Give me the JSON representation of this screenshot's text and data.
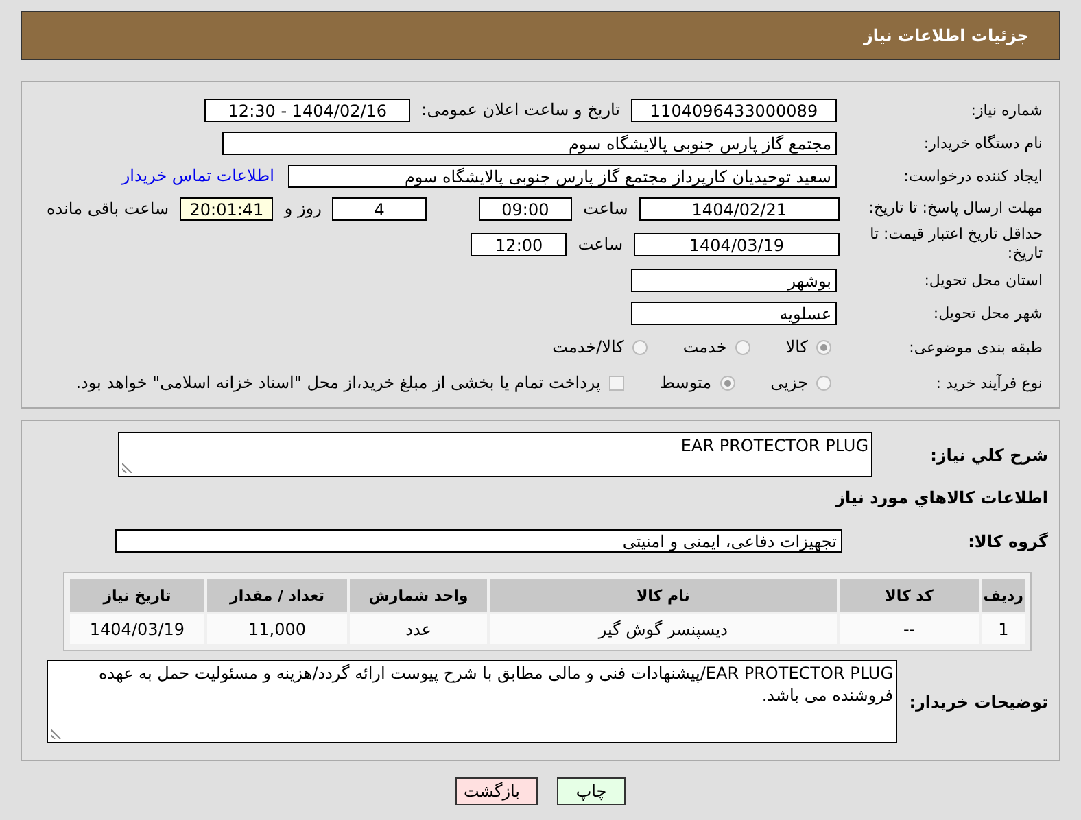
{
  "header": {
    "title": "جزئیات اطلاعات نیاز"
  },
  "need_info": {
    "need_number": {
      "label": "شماره نیاز:",
      "value": "1104096433000089"
    },
    "announce": {
      "label": "تاریخ و ساعت اعلان عمومی:",
      "value": "1404/02/16 - 12:30"
    },
    "buyer_org": {
      "label": "نام دستگاه خریدار:",
      "value": "مجتمع گاز پارس جنوبی  پالایشگاه سوم"
    },
    "requester": {
      "label": "ایجاد کننده درخواست:",
      "value": "سعید توحیدیان کارپرداز مجتمع گاز پارس جنوبی  پالایشگاه سوم",
      "link": "اطلاعات تماس خریدار"
    },
    "reply_deadline": {
      "label": "مهلت ارسال پاسخ: تا تاریخ:",
      "date": "1404/02/21",
      "time_label": "ساعت",
      "time": "09:00",
      "days": "4",
      "days_label": "روز و",
      "remaining": "20:01:41",
      "remaining_label": "ساعت باقی مانده"
    },
    "price_validity": {
      "label": "حداقل تاریخ اعتبار قیمت: تا تاریخ:",
      "date": "1404/03/19",
      "time_label": "ساعت",
      "time": "12:00"
    },
    "province": {
      "label": "استان محل تحویل:",
      "value": "بوشهر"
    },
    "city": {
      "label": "شهر محل تحویل:",
      "value": "عسلویه"
    },
    "category": {
      "label": "طبقه بندی موضوعی:",
      "options": [
        {
          "label": "کالا",
          "selected": true
        },
        {
          "label": "خدمت",
          "selected": false
        },
        {
          "label": "کالا/خدمت",
          "selected": false
        }
      ]
    },
    "process": {
      "label": "نوع فرآیند خرید :",
      "options": [
        {
          "label": "جزیی",
          "selected": false
        },
        {
          "label": "متوسط",
          "selected": true
        }
      ],
      "payment": {
        "checked": false,
        "text": "پرداخت تمام یا بخشی از مبلغ خرید،از محل \"اسناد خزانه اسلامی\" خواهد بود."
      }
    }
  },
  "details": {
    "description": {
      "label": "شرح کلي نیاز:",
      "value": "EAR PROTECTOR PLUG"
    },
    "items_heading": "اطلاعات کالاهاي مورد نياز",
    "goods_group": {
      "label": "گروه کالا:",
      "value": "تجهیزات دفاعی، ایمنی و امنیتی"
    },
    "table": {
      "columns": [
        "ردیف",
        "کد کالا",
        "نام کالا",
        "واحد شمارش",
        "تعداد / مقدار",
        "تاریخ نیاز"
      ],
      "rows": [
        [
          "1",
          "--",
          "دیسپنسر گوش گیر",
          "عدد",
          "11,000",
          "1404/03/19"
        ]
      ]
    },
    "buyer_notes": {
      "label": "توضیحات خریدار:",
      "value": "EAR PROTECTOR PLUG/پیشنهادات فنی و مالی مطابق با شرح پیوست ارائه گردد/هزینه و مسئولیت حمل به عهده فروشنده می باشد."
    }
  },
  "buttons": [
    {
      "label": "چاپ",
      "kind": "print"
    },
    {
      "label": "بازگشت",
      "kind": "back"
    }
  ]
}
